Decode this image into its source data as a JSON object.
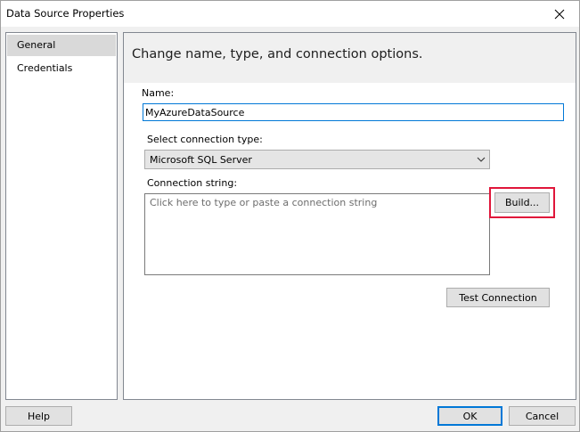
{
  "window": {
    "title": "Data Source Properties"
  },
  "sidebar": {
    "items": [
      {
        "label": "General",
        "selected": true
      },
      {
        "label": "Credentials",
        "selected": false
      }
    ]
  },
  "main": {
    "heading": "Change name, type, and connection options.",
    "name_label": "Name:",
    "name_value": "MyAzureDataSource",
    "type_label": "Select connection type:",
    "type_value": "Microsoft SQL Server",
    "conn_label": "Connection string:",
    "conn_placeholder": "Click here to type or paste a connection string",
    "build_label": "Build...",
    "test_label": "Test Connection"
  },
  "footer": {
    "help_label": "Help",
    "ok_label": "OK",
    "cancel_label": "Cancel"
  },
  "colors": {
    "focus_border": "#0078d7",
    "highlight": "#e0163a",
    "button_face": "#e1e1e1",
    "selected_item": "#d9d9d9"
  }
}
